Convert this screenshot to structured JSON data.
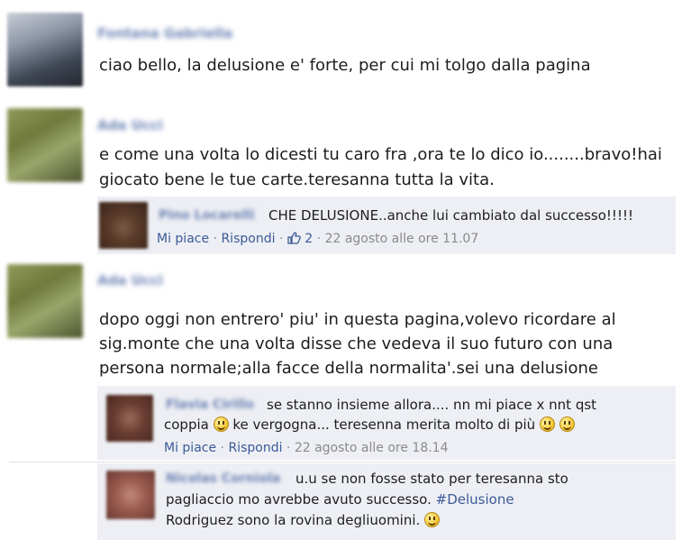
{
  "comments": [
    {
      "author": "Fontana Gabriella",
      "text_lines": [
        "ciao bello, la delusione e' forte, per cui mi tolgo dalla pagina"
      ]
    },
    {
      "author": "Ada Ucci",
      "text_lines": [
        "e come una volta lo dicesti tu caro fra ,ora te lo dico io........bravo!hai",
        "giocato bene le tue carte.teresanna tutta la vita."
      ],
      "replies": [
        {
          "author": "Pino Locarelli",
          "text": "CHE DELUSIONE..anche lui cambiato dal successo!!!!!",
          "like_label": "Mi piace",
          "reply_label": "Rispondi",
          "like_count": "2",
          "timestamp": "22 agosto alle ore 11.07"
        }
      ]
    },
    {
      "author": "Ada Ucci",
      "text_lines": [
        "dopo oggi non entrero' piu' in questa pagina,volevo ricordare al",
        "sig.monte che una volta disse che vedeva il suo futuro con una",
        "persona normale;alla facce della normalita'.sei una delusione"
      ],
      "replies": [
        {
          "author": "Flavia Cirillo",
          "line1": "se stanno insieme allora.... nn mi piace x nnt qst",
          "line2a": "coppia",
          "line2b": "ke vergogna... teresenna merita molto di più",
          "like_label": "Mi piace",
          "reply_label": "Rispondi",
          "timestamp": "22 agosto alle ore 18.14"
        },
        {
          "author": "Nicolas Corniola",
          "line1": "u.u se non fosse stato per teresanna sto",
          "line2": "pagliaccio mo avrebbe avuto successo.",
          "hashtag": "#Delusione",
          "line3": "Rodriguez sono la rovina degliuomini."
        }
      ]
    }
  ],
  "separator": " · ",
  "icons": [
    "avatar",
    "thumbs-up-icon",
    "smiley-icon"
  ],
  "colors": {
    "link": "#3b5998",
    "reply_bg": "#edeff4",
    "meta": "#8a8a8a"
  }
}
